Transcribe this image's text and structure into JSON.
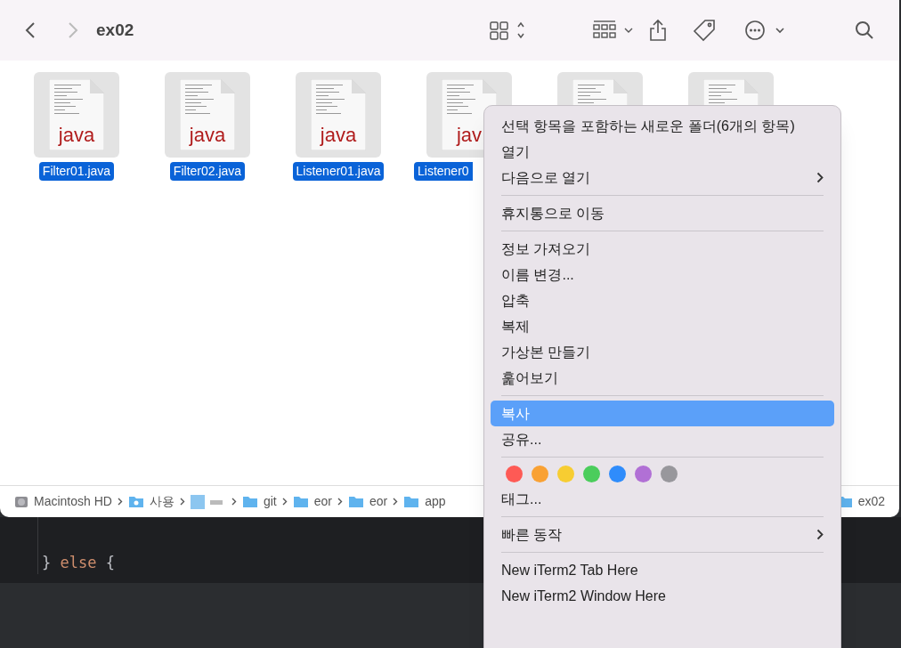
{
  "window": {
    "title": "ex02"
  },
  "files": [
    {
      "kind": "full",
      "name": "Filter01.java",
      "badge": "java",
      "selected": true
    },
    {
      "kind": "full",
      "name": "Filter02.java",
      "badge": "java",
      "selected": true
    },
    {
      "kind": "full",
      "name": "Listener01.java",
      "badge": "java",
      "selected": true
    },
    {
      "kind": "covered",
      "name": "Listener0",
      "badge": "jav",
      "selected": true
    },
    {
      "kind": "hidden",
      "selected": true
    },
    {
      "kind": "hidden",
      "selected": true
    }
  ],
  "path_bar": [
    {
      "kind": "disk",
      "label": "Macintosh HD"
    },
    {
      "kind": "home",
      "label": "사용"
    },
    {
      "kind": "blurred"
    },
    {
      "kind": "folder",
      "label": "git"
    },
    {
      "kind": "folder",
      "label": "eor"
    },
    {
      "kind": "folder",
      "label": "eor"
    },
    {
      "kind": "folder",
      "label": "app"
    },
    {
      "kind": "folder",
      "label": "ex02"
    }
  ],
  "editor": {
    "keyword": "else",
    "before": "} ",
    "after": " {"
  },
  "context_menu": [
    {
      "kind": "item",
      "label": "선택 항목을 포함하는 새로운 폴더(6개의 항목)",
      "selected": false
    },
    {
      "kind": "item",
      "label": "열기",
      "selected": false
    },
    {
      "kind": "submenu",
      "label": "다음으로 열기",
      "selected": false
    },
    {
      "kind": "separator"
    },
    {
      "kind": "item",
      "label": "휴지통으로 이동",
      "selected": false
    },
    {
      "kind": "separator"
    },
    {
      "kind": "item",
      "label": "정보 가져오기",
      "selected": false
    },
    {
      "kind": "item",
      "label": "이름 변경...",
      "selected": false
    },
    {
      "kind": "item",
      "label": "압축",
      "selected": false
    },
    {
      "kind": "item",
      "label": "복제",
      "selected": false
    },
    {
      "kind": "item",
      "label": "가상본 만들기",
      "selected": false
    },
    {
      "kind": "item",
      "label": "훑어보기",
      "selected": false
    },
    {
      "kind": "separator"
    },
    {
      "kind": "item",
      "label": "복사",
      "selected": true
    },
    {
      "kind": "item",
      "label": "공유...",
      "selected": false
    },
    {
      "kind": "separator"
    },
    {
      "kind": "colors",
      "colors": [
        {
          "color": "#fe5a55"
        },
        {
          "color": "#f9a134"
        },
        {
          "color": "#f7cd32"
        },
        {
          "color": "#4bcd5c"
        },
        {
          "color": "#2f8cfb"
        },
        {
          "color": "#b170d5"
        },
        {
          "color": "#98979c"
        }
      ]
    },
    {
      "kind": "item",
      "label": "태그...",
      "selected": false
    },
    {
      "kind": "separator"
    },
    {
      "kind": "submenu",
      "label": "빠른 동작",
      "selected": false
    },
    {
      "kind": "separator"
    },
    {
      "kind": "item",
      "label": "New iTerm2 Tab Here",
      "selected": false
    },
    {
      "kind": "item",
      "label": "New iTerm2 Window Here",
      "selected": false
    }
  ]
}
